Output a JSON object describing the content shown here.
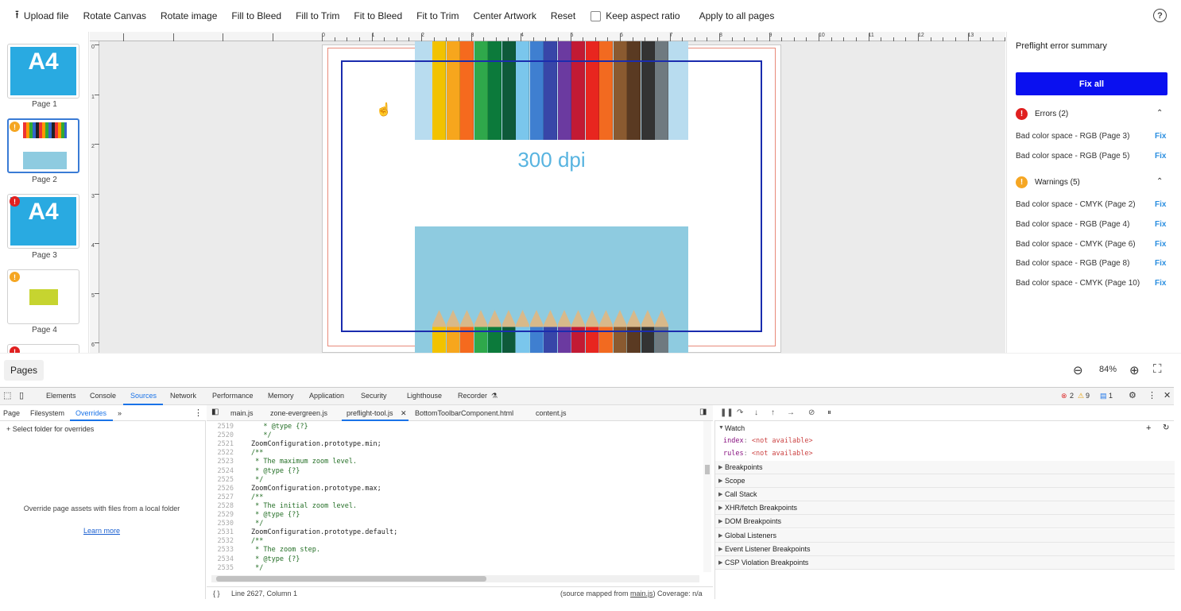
{
  "toolbar": {
    "upload": "Upload file",
    "rotate_canvas": "Rotate Canvas",
    "rotate_image": "Rotate image",
    "fill_bleed": "Fill to Bleed",
    "fill_trim": "Fill to Trim",
    "fit_bleed": "Fit to Bleed",
    "fit_trim": "Fit to Trim",
    "center": "Center Artwork",
    "reset": "Reset",
    "keep_aspect": "Keep aspect ratio",
    "apply_all": "Apply to all pages",
    "help": "?"
  },
  "thumbnails": [
    {
      "label": "Page 1",
      "text": "A4",
      "badge": ""
    },
    {
      "label": "Page 2",
      "text": "",
      "badge": "warning"
    },
    {
      "label": "Page 3",
      "text": "A4",
      "badge": "error"
    },
    {
      "label": "Page 4",
      "text": "",
      "badge": "warning"
    }
  ],
  "ruler": {
    "top": [
      "0",
      "1",
      "2",
      "3",
      "4",
      "5",
      "6",
      "7",
      "8",
      "9",
      "10",
      "11",
      "12",
      "13"
    ],
    "left": [
      "0",
      "1",
      "2",
      "3",
      "4",
      "5",
      "6"
    ]
  },
  "canvas": {
    "dpi_text": "300 dpi"
  },
  "panel": {
    "title": "Preflight error summary",
    "fix_all": "Fix all",
    "errors_head": "Errors (2)",
    "warnings_head": "Warnings (5)",
    "fix_label": "Fix",
    "errors": [
      "Bad color space - RGB (Page 3)",
      "Bad color space - RGB (Page 5)"
    ],
    "warnings": [
      "Bad color space - CMYK (Page 2)",
      "Bad color space - RGB (Page 4)",
      "Bad color space - CMYK (Page 6)",
      "Bad color space - RGB (Page 8)",
      "Bad color space - CMYK (Page 10)"
    ]
  },
  "bottom": {
    "pages": "Pages",
    "zoom": "84%"
  },
  "devtools": {
    "tabs": [
      "Elements",
      "Console",
      "Sources",
      "Network",
      "Performance",
      "Memory",
      "Application",
      "Security",
      "Lighthouse",
      "Recorder"
    ],
    "counts": {
      "errors": "2",
      "warnings": "9",
      "messages": "1"
    },
    "nav_tabs": [
      "Page",
      "Filesystem",
      "Overrides"
    ],
    "select_folder": "Select folder for overrides",
    "override_text": "Override page assets with files from a local folder",
    "learn_more": "Learn more",
    "editor_tabs": [
      "main.js",
      "zone-evergreen.js",
      "preflight-tool.js",
      "BottomToolbarComponent.html",
      "content.js"
    ],
    "code_lines": [
      {
        "n": "2519",
        "t": "   * @type {?}"
      },
      {
        "n": "2520",
        "t": "   */"
      },
      {
        "n": "2521",
        "t": "ZoomConfiguration.prototype.min;"
      },
      {
        "n": "2522",
        "t": "/**"
      },
      {
        "n": "2523",
        "t": " * The maximum zoom level."
      },
      {
        "n": "2524",
        "t": " * @type {?}"
      },
      {
        "n": "2525",
        "t": " */"
      },
      {
        "n": "2526",
        "t": "ZoomConfiguration.prototype.max;"
      },
      {
        "n": "2527",
        "t": "/**"
      },
      {
        "n": "2528",
        "t": " * The initial zoom level."
      },
      {
        "n": "2529",
        "t": " * @type {?}"
      },
      {
        "n": "2530",
        "t": " */"
      },
      {
        "n": "2531",
        "t": "ZoomConfiguration.prototype.default;"
      },
      {
        "n": "2532",
        "t": "/**"
      },
      {
        "n": "2533",
        "t": " * The zoom step."
      },
      {
        "n": "2534",
        "t": " * @type {?}"
      },
      {
        "n": "2535",
        "t": " */"
      }
    ],
    "status_pos": "Line 2627, Column 1",
    "status_src_pre": "(source mapped from ",
    "status_src_file": "main.js",
    "status_src_post": ") Coverage: n/a",
    "watch_label": "Watch",
    "watch_items": [
      {
        "k": "index",
        "v": "<not available>"
      },
      {
        "k": "rules",
        "v": "<not available>"
      }
    ],
    "panes": [
      "Breakpoints",
      "Scope",
      "Call Stack",
      "XHR/fetch Breakpoints",
      "DOM Breakpoints",
      "Global Listeners",
      "Event Listener Breakpoints",
      "CSP Violation Breakpoints"
    ]
  }
}
